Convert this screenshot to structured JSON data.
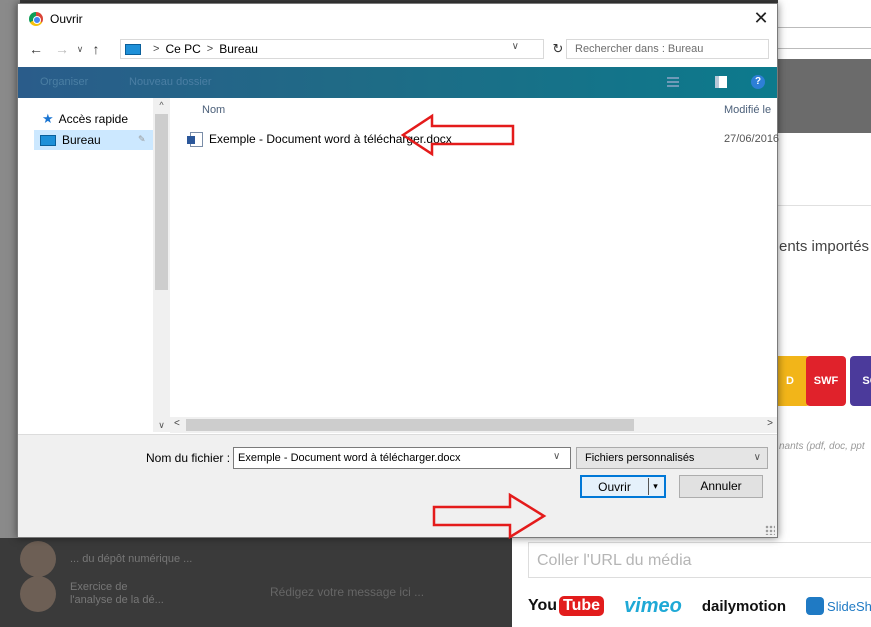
{
  "background": {
    "recent_items": [
      {
        "text": "... du dépôt numérique ..."
      },
      {
        "text": "Exercice de\nl'analyse de la dé..."
      }
    ],
    "bottom_field_hint": "Rédigez votre message ici ...",
    "imports_text": "ents importés",
    "file_tiles": [
      {
        "label": "D",
        "color": "#f2b519"
      },
      {
        "label": "SWF",
        "color": "#e0222b"
      },
      {
        "label": "SC",
        "color": "#4b3a9b"
      }
    ],
    "formats_text": "nants (pdf, doc, ppt",
    "url_placeholder": "Coller l'URL du média",
    "logos": {
      "youtube_you": "You",
      "youtube_tube": "Tube",
      "vimeo": "vimeo",
      "dailymotion": "dailymotion",
      "slideshare": "SlideShare"
    }
  },
  "dialog": {
    "title": "Ouvrir",
    "close_glyph": "✕",
    "nav": {
      "back": "←",
      "forward": "→",
      "recent": "∨",
      "up": "↑",
      "breadcrumb": [
        "Ce PC",
        "Bureau"
      ],
      "crumb_sep": ">",
      "address_dropdown": "∨",
      "refresh": "↻",
      "search_placeholder": "Rechercher dans : Bureau"
    },
    "toolbar": {
      "organiser": "Organiser",
      "new_folder": "Nouveau dossier",
      "help": "?"
    },
    "sidebar": {
      "quick_access": "Accès rapide",
      "bureau": "Bureau",
      "scroll_up": "^",
      "scroll_down": "∨"
    },
    "file_list": {
      "columns": {
        "name": "Nom",
        "modified": "Modifié le"
      },
      "files": [
        {
          "name": "Exemple - Document word à télécharger.docx",
          "modified": "27/06/2016"
        }
      ]
    },
    "hscroll": {
      "left": "<",
      "right": ">"
    },
    "footer": {
      "filename_label": "Nom du fichier :",
      "filename_value": "Exemple - Document word à télécharger.docx",
      "filename_dropdown": "∨",
      "filetype": "Fichiers personnalisés",
      "filetype_chevron": "∨",
      "open": "Ouvrir",
      "open_split": "▾",
      "cancel": "Annuler"
    }
  },
  "annotations": {
    "arrow_color": "#e41b1b"
  }
}
